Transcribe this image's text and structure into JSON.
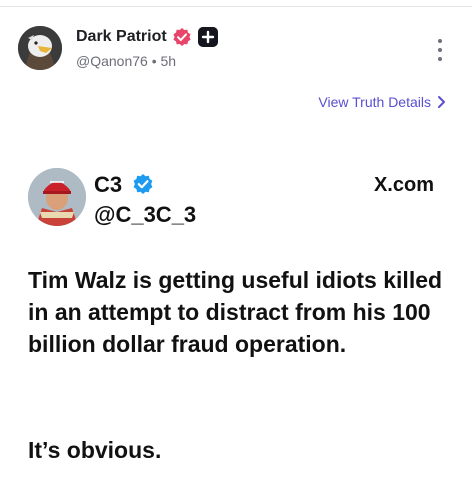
{
  "post": {
    "author_name": "Dark Patriot",
    "author_handle": "@Qanon76 • 5h",
    "avatar_icon": "eagle-avatar",
    "verified_icon": "verified-check-icon",
    "plus_icon": "plus-badge-icon",
    "more_icon": "more-vertical-icon"
  },
  "details_link": {
    "label": "View Truth Details",
    "icon": "chevron-right-icon"
  },
  "embed": {
    "name": "C3",
    "handle": "@C_3C_3",
    "source": "X.com",
    "avatar_icon": "user-avatar",
    "verified_icon": "blue-verified-icon",
    "text_paragraph_1": "Tim Walz is getting useful idiots killed in an attempt to distract from his 100 billion dollar fraud operation.",
    "text_paragraph_2": "It’s obvious."
  },
  "colors": {
    "accent_link": "#5a4fcf",
    "verified_pink": "#e9456a",
    "verified_blue": "#1d9bf0",
    "muted_text": "#6d6d78"
  }
}
